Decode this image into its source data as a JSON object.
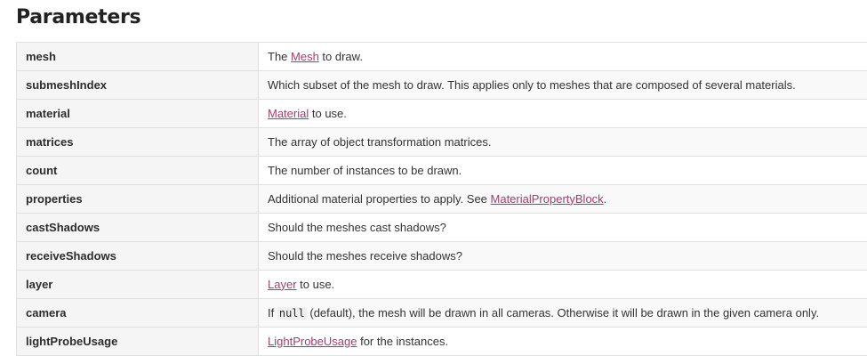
{
  "page": {
    "title": "Parameters"
  },
  "params": [
    {
      "name": "mesh",
      "pre": "The ",
      "link": "Mesh",
      "post": " to draw."
    },
    {
      "name": "submeshIndex",
      "pre": "Which subset of the mesh to draw. This applies only to meshes that are composed of several materials."
    },
    {
      "name": "material",
      "pre": "",
      "link": "Material",
      "post": " to use."
    },
    {
      "name": "matrices",
      "pre": "The array of object transformation matrices."
    },
    {
      "name": "count",
      "pre": "The number of instances to be drawn."
    },
    {
      "name": "properties",
      "pre": "Additional material properties to apply. See ",
      "link": "MaterialPropertyBlock",
      "post": "."
    },
    {
      "name": "castShadows",
      "pre": "Should the meshes cast shadows?"
    },
    {
      "name": "receiveShadows",
      "pre": "Should the meshes receive shadows?"
    },
    {
      "name": "layer",
      "pre": "",
      "link": "Layer",
      "post": " to use."
    },
    {
      "name": "camera",
      "pre": "If ",
      "code": "null",
      "post": " (default), the mesh will be drawn in all cameras. Otherwise it will be drawn in the given camera only."
    },
    {
      "name": "lightProbeUsage",
      "pre": "",
      "link": "LightProbeUsage",
      "post": " for the instances."
    }
  ],
  "colors": {
    "link": "#a13d73",
    "name_cell_bg": "#f5f5f5",
    "border": "#e0e0e0"
  }
}
